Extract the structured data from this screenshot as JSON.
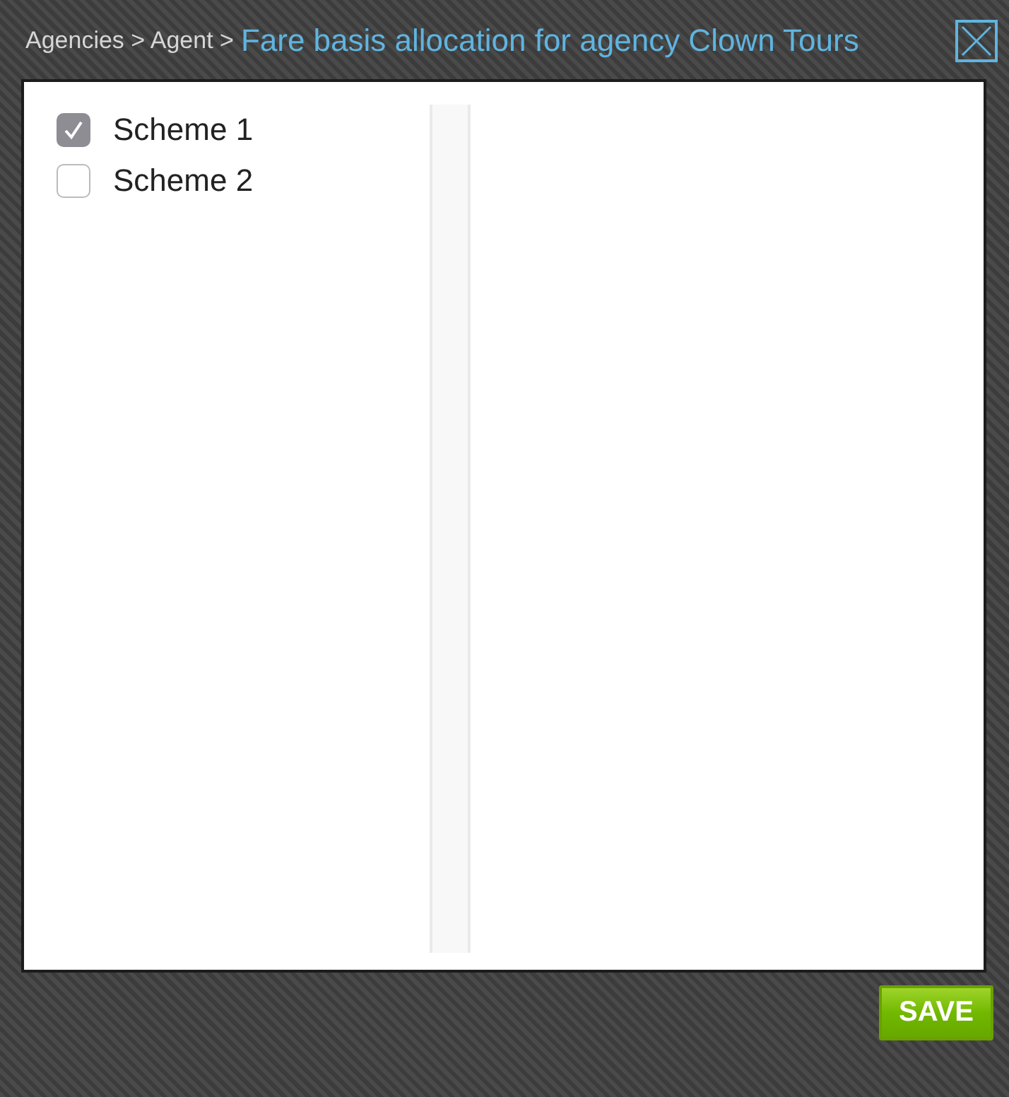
{
  "header": {
    "breadcrumb": "Agencies > Agent >",
    "title": "Fare basis allocation for agency Clown Tours"
  },
  "schemes": [
    {
      "label": "Scheme 1",
      "checked": true
    },
    {
      "label": "Scheme 2",
      "checked": false
    }
  ],
  "buttons": [
    {
      "label": "SAVE"
    }
  ]
}
